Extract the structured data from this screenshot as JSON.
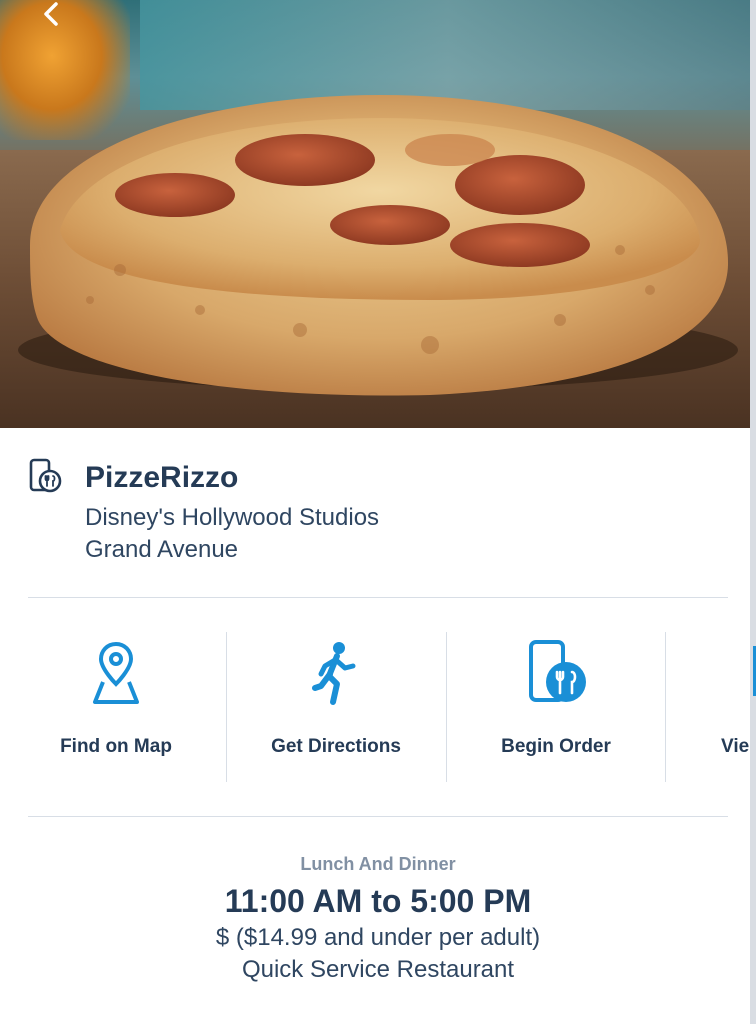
{
  "restaurant": {
    "name": "PizzeRizzo",
    "park": "Disney's Hollywood Studios",
    "area": "Grand Avenue"
  },
  "actions": [
    {
      "label": "Find on Map",
      "icon": "map-pin-icon"
    },
    {
      "label": "Get Directions",
      "icon": "walking-person-icon"
    },
    {
      "label": "Begin Order",
      "icon": "mobile-order-icon"
    },
    {
      "label": "Vie",
      "icon": "partial-action-icon"
    }
  ],
  "hours": {
    "meal_period": "Lunch And Dinner",
    "time_range": "11:00 AM to 5:00 PM",
    "price": "$ ($14.99 and under per adult)",
    "service_type": "Quick Service Restaurant"
  },
  "colors": {
    "accent": "#1a8fd6",
    "title": "#253b56",
    "muted": "#8190a3",
    "divider": "#d8dee6"
  }
}
